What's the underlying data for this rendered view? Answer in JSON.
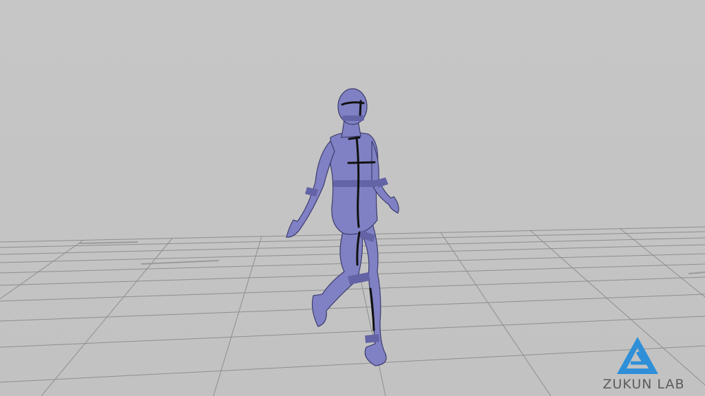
{
  "watermark": {
    "brand_text": "ZUKUN LAB",
    "logo_icon": "triangle-logo-icon",
    "logo_color": "#2f8fd8",
    "text_color": "#5b5b5b"
  },
  "scene": {
    "background_color": "#c4c4c4",
    "grid_color": "#8e8e8e",
    "figure_color": "#8080c4",
    "figure_band_color": "#6363a6",
    "marker_color": "#111111"
  }
}
